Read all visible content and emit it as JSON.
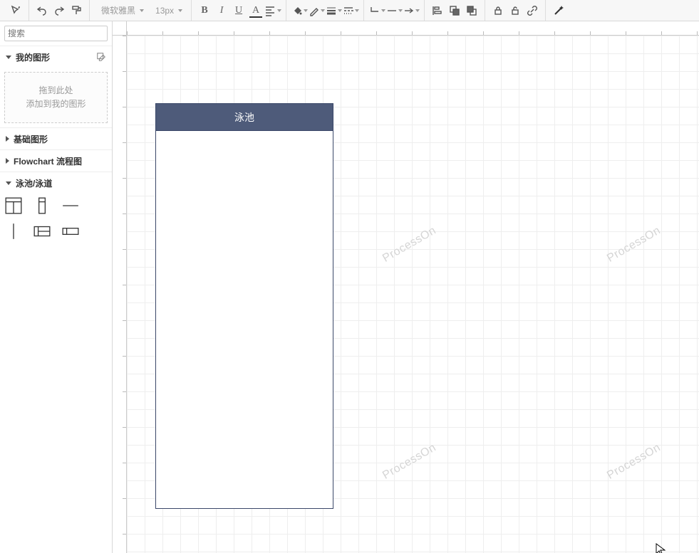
{
  "toolbar": {
    "font_family": "微软雅黑",
    "font_size": "13px"
  },
  "sidebar": {
    "search_placeholder": "搜索",
    "categories": {
      "my_shapes": {
        "label": "我的图形"
      },
      "basic": {
        "label": "基础图形"
      },
      "flowchart": {
        "label": "Flowchart 流程图"
      },
      "pool": {
        "label": "泳池/泳道"
      }
    },
    "dropzone_line1": "拖到此处",
    "dropzone_line2": "添加到我的图形"
  },
  "canvas": {
    "pool_shape_title": "泳池",
    "watermark_text": "ProcessOn"
  }
}
